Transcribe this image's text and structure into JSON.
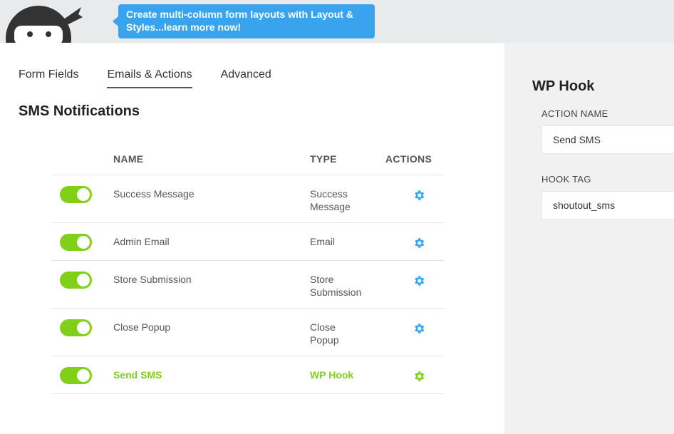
{
  "banner": {
    "tooltip_text": "Create multi-column form layouts with Layout & Styles...learn more now!",
    "mascot_icon": "ninja-mascot-icon"
  },
  "tabs": [
    {
      "label": "Form Fields",
      "active": false
    },
    {
      "label": "Emails & Actions",
      "active": true
    },
    {
      "label": "Advanced",
      "active": false
    }
  ],
  "main": {
    "section_title": "SMS Notifications",
    "columns": {
      "name": "NAME",
      "type": "TYPE",
      "actions": "ACTIONS"
    },
    "rows": [
      {
        "enabled": true,
        "name": "Success Message",
        "type_line1": "Success",
        "type_line2": "Message",
        "active": false
      },
      {
        "enabled": true,
        "name": "Admin Email",
        "type_line1": "Email",
        "type_line2": "",
        "active": false
      },
      {
        "enabled": true,
        "name": "Store Submission",
        "type_line1": "Store",
        "type_line2": "Submission",
        "active": false
      },
      {
        "enabled": true,
        "name": "Close Popup",
        "type_line1": "Close",
        "type_line2": "Popup",
        "active": false
      },
      {
        "enabled": true,
        "name": "Send SMS",
        "type_line1": "WP Hook",
        "type_line2": "",
        "active": true
      }
    ]
  },
  "side_panel": {
    "title": "WP Hook",
    "action_name_label": "ACTION NAME",
    "action_name_value": "Send SMS",
    "hook_tag_label": "HOOK TAG",
    "hook_tag_value": "shoutout_sms"
  },
  "colors": {
    "accent_green": "#80d01a",
    "tooltip_blue": "#3aa3ee",
    "gear_blue": "#3aa3ee"
  }
}
